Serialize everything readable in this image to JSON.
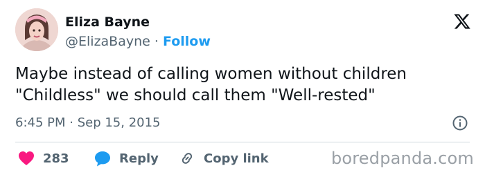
{
  "author": {
    "display_name": "Eliza Bayne",
    "handle": "@ElizaBayne",
    "separator": "·",
    "follow_label": "Follow",
    "avatar_icon": "user-avatar-photo"
  },
  "tweet": {
    "text_lines": [
      "Maybe instead of calling women without children",
      "\"Childless\" we should call them \"Well-rested\""
    ],
    "timestamp": "6:45 PM · Sep 15, 2015"
  },
  "actions": {
    "like_count": "283",
    "reply_label": "Reply",
    "copy_link_label": "Copy link"
  },
  "watermark": "boredpanda.com",
  "colors": {
    "follow_blue": "#1d9bf0",
    "heart_red": "#f91880",
    "reply_blue": "#1d9bf0",
    "muted_text": "#536471"
  },
  "icons": [
    "x-logo-icon",
    "info-icon",
    "heart-icon",
    "reply-bubble-icon",
    "link-icon"
  ]
}
